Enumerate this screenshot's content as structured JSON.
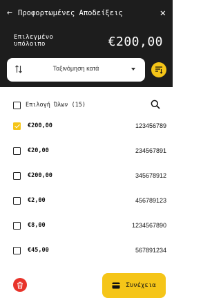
{
  "header": {
    "title": "Προφορτωμένες Αποδείξεις",
    "balance_label": "Επιλεγμένο υπόλοιπο",
    "balance_value": "€200,00"
  },
  "sort": {
    "label": "Ταξινόμηση κατά"
  },
  "select_all": {
    "label": "Επιλογή Όλων (15)"
  },
  "receipts": [
    {
      "amount": "€200,00",
      "number": "123456789",
      "checked": true
    },
    {
      "amount": "€20,00",
      "number": "234567891",
      "checked": false
    },
    {
      "amount": "€200,00",
      "number": "345678912",
      "checked": false
    },
    {
      "amount": "€2,00",
      "number": "456789123",
      "checked": false
    },
    {
      "amount": "€8,00",
      "number": "1234567890",
      "checked": false
    },
    {
      "amount": "€45,00",
      "number": "567891234",
      "checked": false
    }
  ],
  "footer": {
    "continue_label": "Συνέχεια"
  },
  "colors": {
    "header_bg": "#1d1d1d",
    "accent": "#f5c518",
    "danger": "#e8332a"
  },
  "icons": [
    "back-arrow-icon",
    "close-icon",
    "sort-arrows-icon",
    "chevron-down-icon",
    "sort-descending-icon",
    "search-icon",
    "trash-icon",
    "wallet-icon"
  ]
}
